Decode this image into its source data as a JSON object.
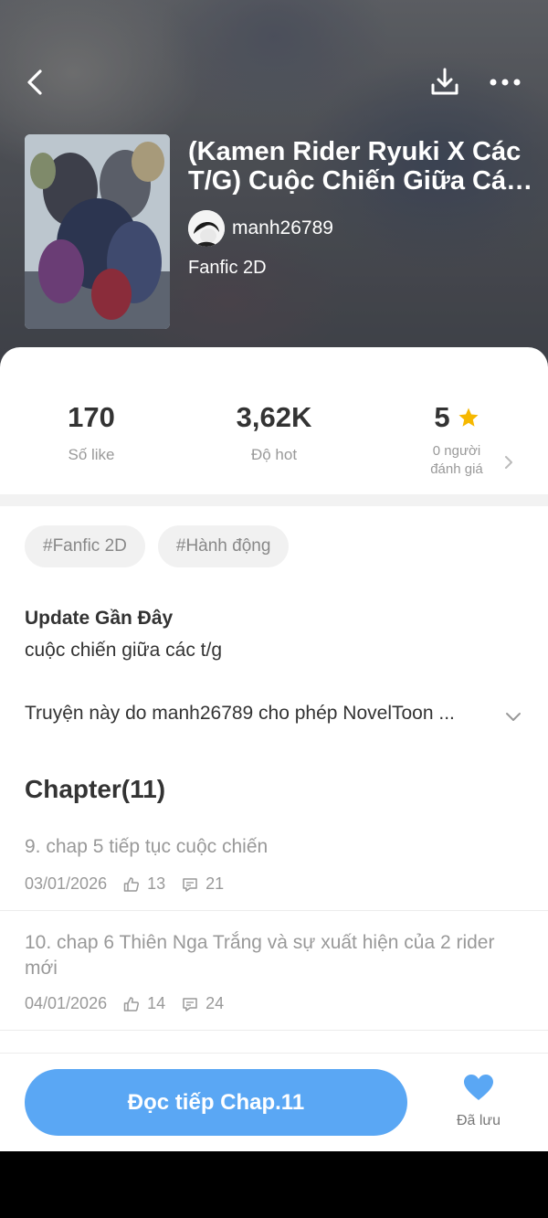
{
  "header": {
    "back_icon": "chevron-left-icon",
    "download_icon": "download-icon",
    "more_icon": "more-dots-icon",
    "title": "(Kamen Rider Ryuki X Các T/G) Cuộc Chiến Giữa Các Thế Giới",
    "author": "manh26789",
    "genre": "Fanfic 2D"
  },
  "stats": {
    "likes_value": "170",
    "likes_label": "Số like",
    "hot_value": "3,62K",
    "hot_label": "Độ hot",
    "rating_value": "5",
    "rating_label_line1": "0 người",
    "rating_label_line2": "đánh giá",
    "star_color": "#f6b800"
  },
  "tags": [
    "#Fanfic 2D",
    "#Hành động"
  ],
  "update": {
    "title": "Update Gần Đây",
    "desc": "cuộc chiến giữa các t/g"
  },
  "permission_text": "Truyện này do manh26789 cho phép NovelToon ...",
  "chapters": {
    "header": "Chapter(11)",
    "items": [
      {
        "title": "9. chap 5 tiếp tục cuộc chiến",
        "date": "03/01/2026",
        "likes": "13",
        "comments": "21"
      },
      {
        "title": "10. chap 6 Thiên Nga Trắng và sự xuất hiện của 2 rider mới",
        "date": "04/01/2026",
        "likes": "14",
        "comments": "24"
      }
    ]
  },
  "bottom": {
    "read_label": "Đọc tiếp Chap.11",
    "save_label": "Đã lưu",
    "accent": "#5aa7f4"
  }
}
